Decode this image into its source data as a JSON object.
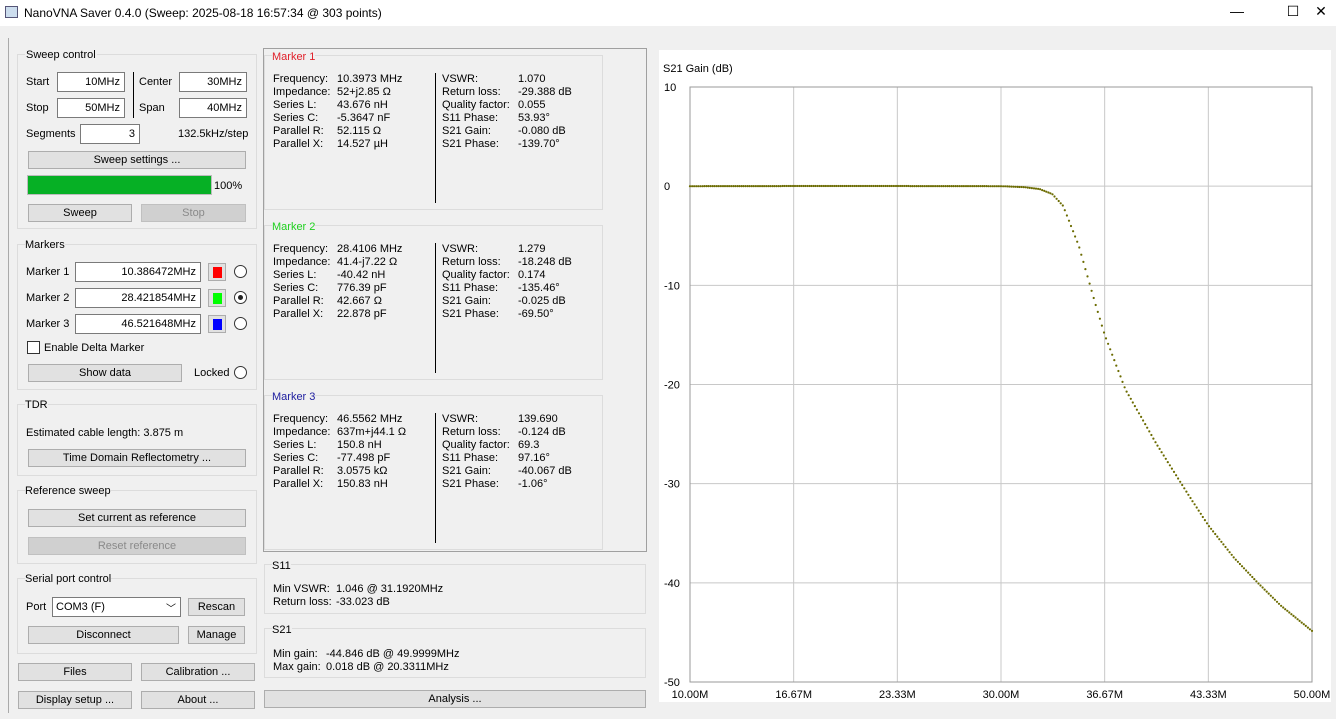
{
  "window": {
    "title": "NanoVNA Saver 0.4.0 (Sweep: 2025-08-18 16:57:34 @ 303 points)",
    "minimize": "—",
    "maximize": "☐",
    "close": "✕"
  },
  "sweep": {
    "title": "Sweep control",
    "start_label": "Start",
    "start": "10MHz",
    "center_label": "Center",
    "center": "30MHz",
    "stop_label": "Stop",
    "stop": "50MHz",
    "span_label": "Span",
    "span": "40MHz",
    "segments_label": "Segments",
    "segments": "3",
    "step": "132.5kHz/step",
    "settings_btn": "Sweep settings ...",
    "progress": 100,
    "progress_text": "100%",
    "sweep_btn": "Sweep",
    "stop_btn": "Stop"
  },
  "markers": {
    "title": "Markers",
    "items": [
      {
        "label": "Marker 1",
        "value": "10.386472MHz",
        "color": "#ff0000",
        "selected": false
      },
      {
        "label": "Marker 2",
        "value": "28.421854MHz",
        "color": "#00ff00",
        "selected": true
      },
      {
        "label": "Marker 3",
        "value": "46.521648MHz",
        "color": "#0000ff",
        "selected": false
      }
    ],
    "delta_label": "Enable Delta Marker",
    "show_data": "Show data",
    "locked": "Locked"
  },
  "tdr": {
    "title": "TDR",
    "cable": "Estimated cable length:  3.875 m",
    "btn": "Time Domain Reflectometry ..."
  },
  "reference": {
    "title": "Reference sweep",
    "set": "Set current as reference",
    "reset": "Reset reference"
  },
  "serial": {
    "title": "Serial port control",
    "port_label": "Port",
    "port": "COM3 (F)",
    "rescan": "Rescan",
    "disconnect": "Disconnect",
    "manage": "Manage"
  },
  "bottom": {
    "files": "Files",
    "calibration": "Calibration ...",
    "display": "Display setup ...",
    "about": "About ...",
    "analysis": "Analysis ..."
  },
  "marker_panels": [
    {
      "title": "Marker 1",
      "color": "#e0202a",
      "left": [
        [
          "Frequency:",
          "10.3973 MHz"
        ],
        [
          "Impedance:",
          "52+j2.85 Ω"
        ],
        [
          "Series L:",
          "43.676 nH"
        ],
        [
          "Series C:",
          "-5.3647 nF"
        ],
        [
          "Parallel R:",
          "52.115 Ω"
        ],
        [
          "Parallel X:",
          "14.527 µH"
        ]
      ],
      "right": [
        [
          "VSWR:",
          "1.070"
        ],
        [
          "Return loss:",
          "-29.388 dB"
        ],
        [
          "Quality factor:",
          "0.055"
        ],
        [
          "S11 Phase:",
          "53.93°"
        ],
        [
          "S21 Gain:",
          "-0.080 dB"
        ],
        [
          "S21 Phase:",
          "-139.70°"
        ]
      ]
    },
    {
      "title": "Marker 2",
      "color": "#20d020",
      "left": [
        [
          "Frequency:",
          "28.4106 MHz"
        ],
        [
          "Impedance:",
          "41.4-j7.22 Ω"
        ],
        [
          "Series L:",
          "-40.42 nH"
        ],
        [
          "Series C:",
          "776.39 pF"
        ],
        [
          "Parallel R:",
          "42.667 Ω"
        ],
        [
          "Parallel X:",
          "22.878 pF"
        ]
      ],
      "right": [
        [
          "VSWR:",
          "1.279"
        ],
        [
          "Return loss:",
          "-18.248 dB"
        ],
        [
          "Quality factor:",
          "0.174"
        ],
        [
          "S11 Phase:",
          "-135.46°"
        ],
        [
          "S21 Gain:",
          "-0.025 dB"
        ],
        [
          "S21 Phase:",
          "-69.50°"
        ]
      ]
    },
    {
      "title": "Marker 3",
      "color": "#2020a0",
      "left": [
        [
          "Frequency:",
          "46.5562 MHz"
        ],
        [
          "Impedance:",
          "637m+j44.1 Ω"
        ],
        [
          "Series L:",
          "150.8 nH"
        ],
        [
          "Series C:",
          "-77.498 pF"
        ],
        [
          "Parallel R:",
          "3.0575 kΩ"
        ],
        [
          "Parallel X:",
          "150.83 nH"
        ]
      ],
      "right": [
        [
          "VSWR:",
          "139.690"
        ],
        [
          "Return loss:",
          "-0.124 dB"
        ],
        [
          "Quality factor:",
          "69.3"
        ],
        [
          "S11 Phase:",
          "97.16°"
        ],
        [
          "S21 Gain:",
          "-40.067 dB"
        ],
        [
          "S21 Phase:",
          "-1.06°"
        ]
      ]
    }
  ],
  "s11": {
    "title": "S11",
    "vswr_label": "Min VSWR:",
    "vswr": "1.046 @ 31.1920MHz",
    "rl_label": "Return loss:",
    "rl": "-33.023 dB"
  },
  "s21": {
    "title": "S21",
    "min_label": "Min gain:",
    "min": "-44.846 dB @ 49.9999MHz",
    "max_label": "Max gain:",
    "max": "0.018 dB @ 20.3311MHz"
  },
  "chart_data": {
    "type": "scatter",
    "title": "S21 Gain (dB)",
    "xlim": [
      10,
      50
    ],
    "ylim": [
      -50,
      10
    ],
    "xticks": [
      "10.00M",
      "16.67M",
      "23.33M",
      "30.00M",
      "36.67M",
      "43.33M",
      "50.00M"
    ],
    "yticks": [
      "10",
      "0",
      "-10",
      "-20",
      "-30",
      "-40",
      "-50"
    ],
    "points": 303,
    "color": "#6b6b00",
    "x": [
      10,
      20,
      30,
      31.5,
      32.5,
      33.3,
      34,
      35,
      36,
      36.67,
      38,
      40,
      42,
      43.33,
      45,
      46.56,
      48,
      50
    ],
    "y": [
      0,
      0.02,
      0,
      -0.1,
      -0.3,
      -0.8,
      -2,
      -6,
      -11.5,
      -15,
      -20.5,
      -26,
      -31,
      -34.2,
      -37.5,
      -40.07,
      -42.3,
      -44.85
    ]
  }
}
